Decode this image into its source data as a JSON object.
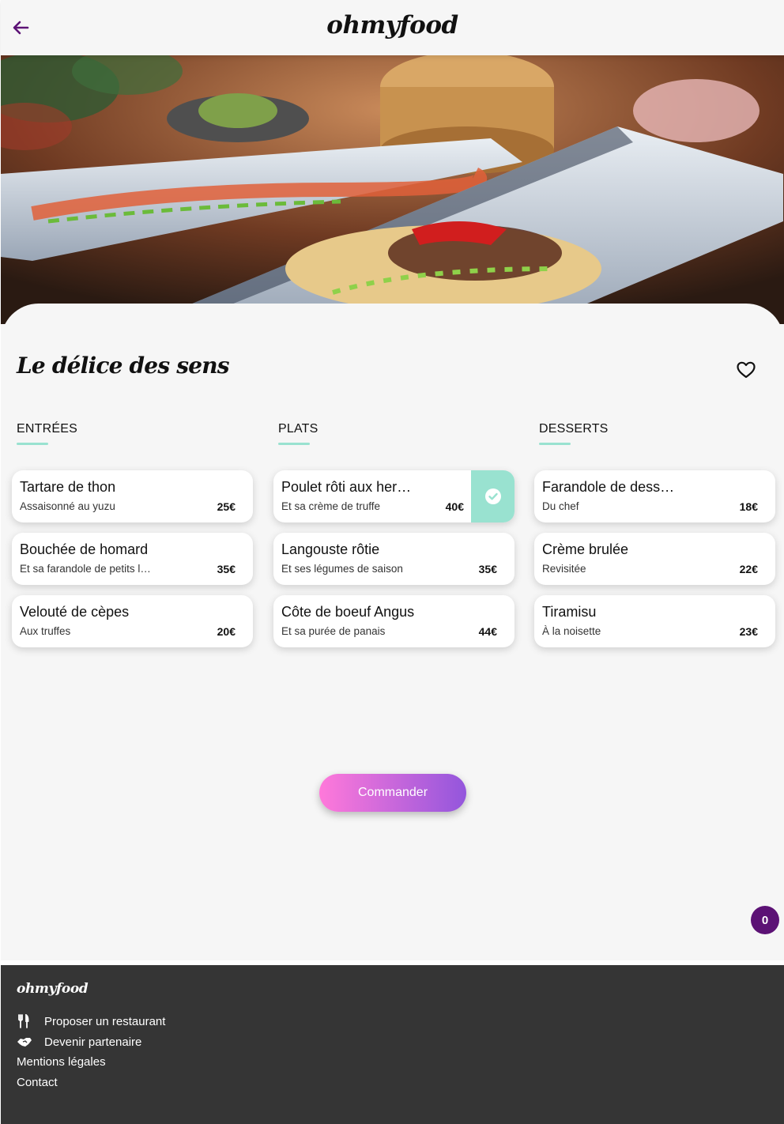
{
  "header": {
    "logo": "ohmyfood",
    "back_icon": "arrow-left-icon"
  },
  "restaurant": {
    "name": "Le délice des sens",
    "favorite_icon": "heart-outline-icon"
  },
  "menu": {
    "columns": [
      {
        "title": "ENTRÉES",
        "dishes": [
          {
            "name": "Tartare de thon",
            "description": "Assaisonné au yuzu",
            "price": "25€"
          },
          {
            "name": "Bouchée de homard",
            "description": "Et sa farandole de petits légumes",
            "price": "35€"
          },
          {
            "name": "Velouté de cèpes",
            "description": "Aux truffes",
            "price": "20€"
          }
        ]
      },
      {
        "title": "PLATS",
        "dishes": [
          {
            "name": "Poulet rôti aux herbes",
            "description": "Et sa crème de truffe",
            "price": "40€",
            "selected": true
          },
          {
            "name": "Langouste rôtie",
            "description": "Et ses légumes de saison",
            "price": "35€"
          },
          {
            "name": "Côte de boeuf Angus",
            "description": "Et sa purée de panais",
            "price": "44€"
          }
        ]
      },
      {
        "title": "DESSERTS",
        "dishes": [
          {
            "name": "Farandole de desserts",
            "description": "Du chef",
            "price": "18€"
          },
          {
            "name": "Crème brulée",
            "description": "Revisitée",
            "price": "22€"
          },
          {
            "name": "Tiramisu",
            "description": "À la noisette",
            "price": "23€"
          }
        ]
      }
    ]
  },
  "order_button": "Commander",
  "cart": {
    "count": "0"
  },
  "footer": {
    "logo": "ohmyfood",
    "links": [
      {
        "label": "Proposer un restaurant",
        "icon": "utensils-icon"
      },
      {
        "label": "Devenir partenaire",
        "icon": "handshake-icon"
      },
      {
        "label": "Mentions légales"
      },
      {
        "label": "Contact"
      }
    ]
  },
  "colors": {
    "accent_purple": "#5c1275",
    "accent_mint": "#99e2d0",
    "button_gradient_start": "#ff79da",
    "button_gradient_end": "#9356dc",
    "footer_bg": "#353535",
    "page_bg": "#f6f6f6"
  }
}
